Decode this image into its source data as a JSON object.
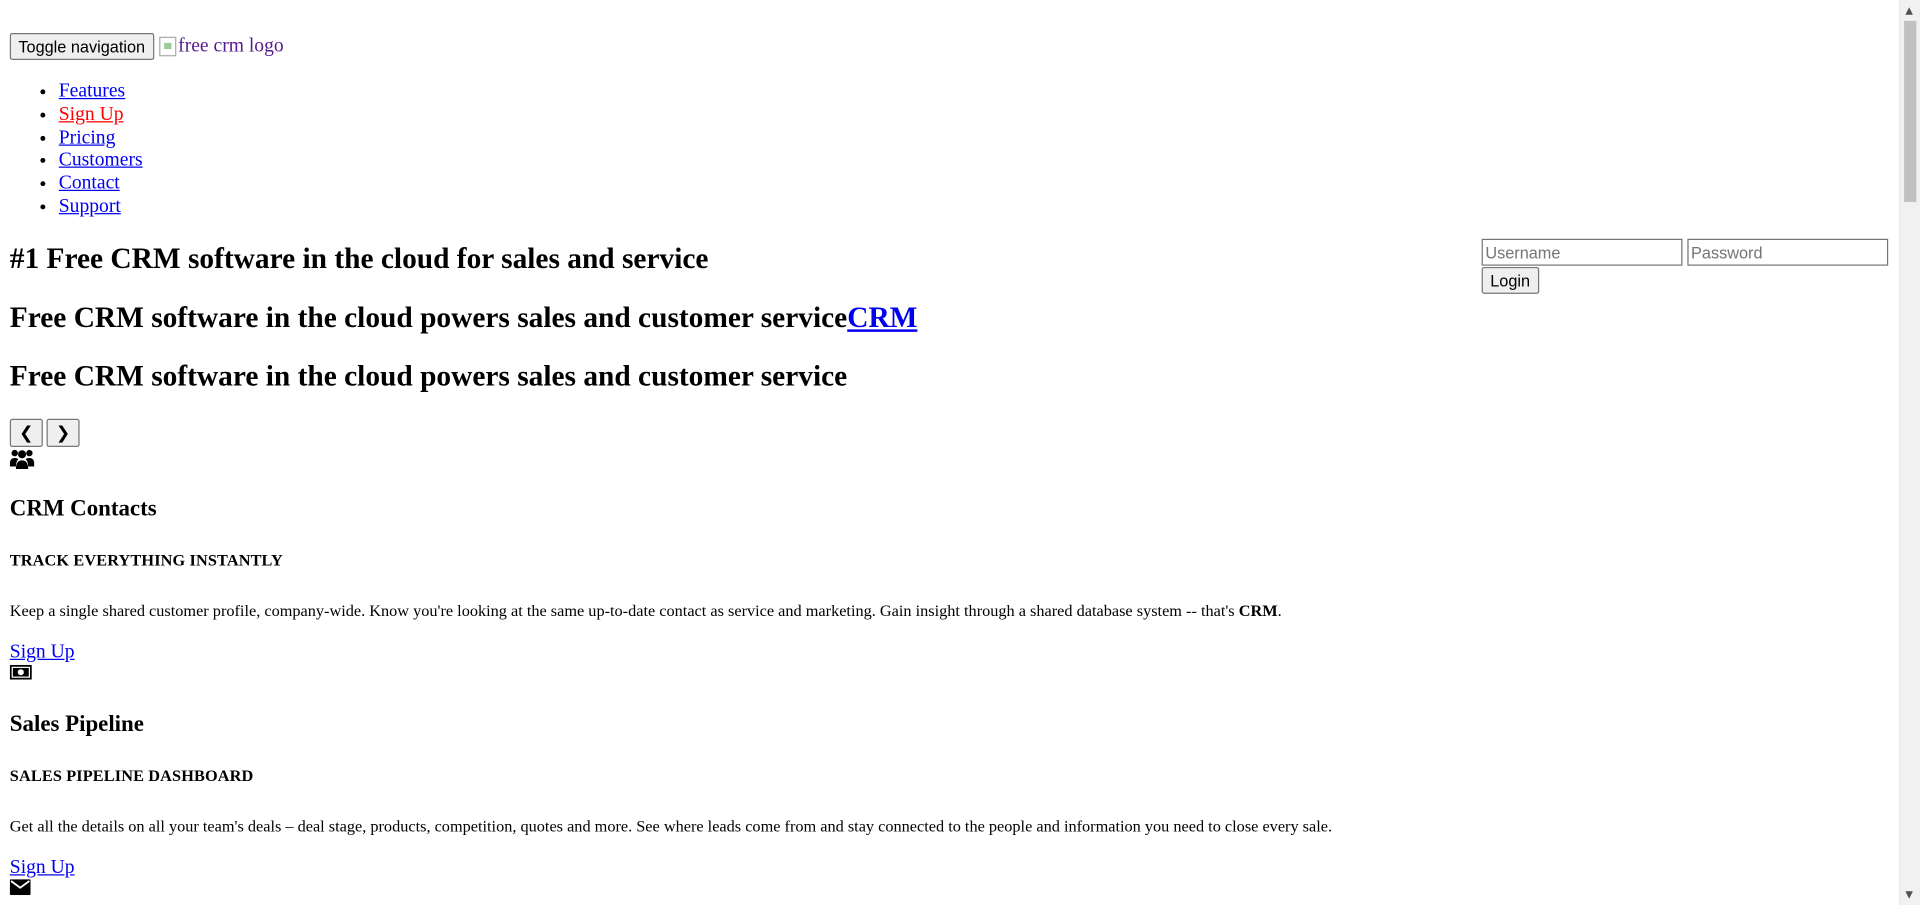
{
  "header": {
    "toggle_label": "Toggle navigation",
    "logo_alt": "free crm logo"
  },
  "menu": {
    "items": [
      {
        "label": "Features"
      },
      {
        "label": "Sign Up"
      },
      {
        "label": "Pricing"
      },
      {
        "label": "Customers"
      },
      {
        "label": "Contact"
      },
      {
        "label": "Support"
      }
    ]
  },
  "login": {
    "username_placeholder": "Username",
    "password_placeholder": "Password",
    "login_label": "Login"
  },
  "hero": {
    "title": "#1 Free CRM software in the cloud for sales and service",
    "subtitle1": "Free CRM software in the cloud powers sales and customer service",
    "subtitle1_link": "CRM",
    "subtitle2": "Free CRM software in the cloud powers sales and customer service"
  },
  "carousel": {
    "prev_icon": "chevron-left-icon",
    "next_icon": "chevron-right-icon"
  },
  "features": [
    {
      "icon": "users-icon",
      "title": "CRM Contacts",
      "subtitle": "TRACK EVERYTHING INSTANTLY",
      "body": "Keep a single shared customer profile, company-wide. Know you're looking at the same up-to-date contact as service and marketing. Gain insight through a shared database system -- that's ",
      "body_strong": "CRM",
      "body_end": ".",
      "link": "Sign Up"
    },
    {
      "icon": "money-icon",
      "title": "Sales Pipeline",
      "subtitle": "SALES PIPELINE DASHBOARD",
      "body": "Get all the details on all your team's deals – deal stage, products, competition, quotes and more. See where leads come from and stay connected to the people and information you need to close every sale.",
      "link": "Sign Up"
    }
  ],
  "next_feature_icon": "envelope-icon"
}
